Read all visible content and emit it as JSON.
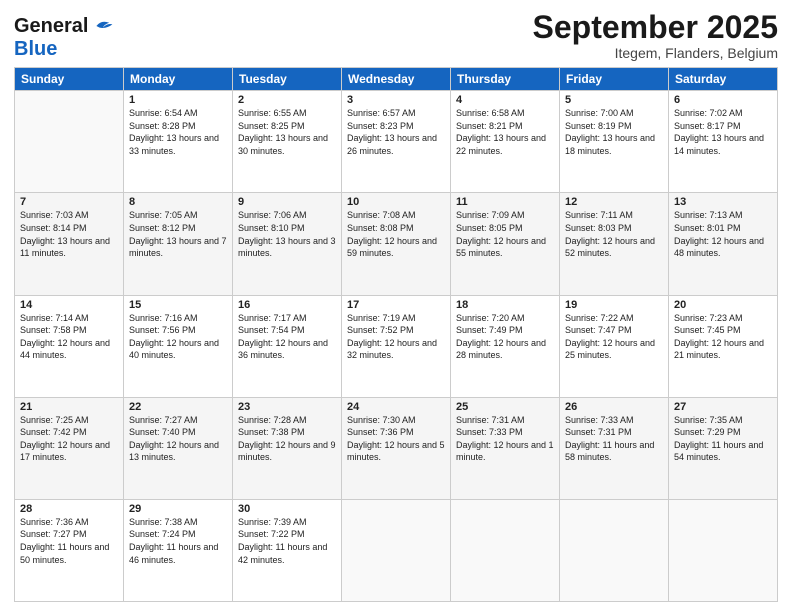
{
  "logo": {
    "line1": "General",
    "line2": "Blue"
  },
  "title": "September 2025",
  "subtitle": "Itegem, Flanders, Belgium",
  "days_header": [
    "Sunday",
    "Monday",
    "Tuesday",
    "Wednesday",
    "Thursday",
    "Friday",
    "Saturday"
  ],
  "weeks": [
    [
      {
        "num": "",
        "sunrise": "",
        "sunset": "",
        "daylight": ""
      },
      {
        "num": "1",
        "sunrise": "Sunrise: 6:54 AM",
        "sunset": "Sunset: 8:28 PM",
        "daylight": "Daylight: 13 hours and 33 minutes."
      },
      {
        "num": "2",
        "sunrise": "Sunrise: 6:55 AM",
        "sunset": "Sunset: 8:25 PM",
        "daylight": "Daylight: 13 hours and 30 minutes."
      },
      {
        "num": "3",
        "sunrise": "Sunrise: 6:57 AM",
        "sunset": "Sunset: 8:23 PM",
        "daylight": "Daylight: 13 hours and 26 minutes."
      },
      {
        "num": "4",
        "sunrise": "Sunrise: 6:58 AM",
        "sunset": "Sunset: 8:21 PM",
        "daylight": "Daylight: 13 hours and 22 minutes."
      },
      {
        "num": "5",
        "sunrise": "Sunrise: 7:00 AM",
        "sunset": "Sunset: 8:19 PM",
        "daylight": "Daylight: 13 hours and 18 minutes."
      },
      {
        "num": "6",
        "sunrise": "Sunrise: 7:02 AM",
        "sunset": "Sunset: 8:17 PM",
        "daylight": "Daylight: 13 hours and 14 minutes."
      }
    ],
    [
      {
        "num": "7",
        "sunrise": "Sunrise: 7:03 AM",
        "sunset": "Sunset: 8:14 PM",
        "daylight": "Daylight: 13 hours and 11 minutes."
      },
      {
        "num": "8",
        "sunrise": "Sunrise: 7:05 AM",
        "sunset": "Sunset: 8:12 PM",
        "daylight": "Daylight: 13 hours and 7 minutes."
      },
      {
        "num": "9",
        "sunrise": "Sunrise: 7:06 AM",
        "sunset": "Sunset: 8:10 PM",
        "daylight": "Daylight: 13 hours and 3 minutes."
      },
      {
        "num": "10",
        "sunrise": "Sunrise: 7:08 AM",
        "sunset": "Sunset: 8:08 PM",
        "daylight": "Daylight: 12 hours and 59 minutes."
      },
      {
        "num": "11",
        "sunrise": "Sunrise: 7:09 AM",
        "sunset": "Sunset: 8:05 PM",
        "daylight": "Daylight: 12 hours and 55 minutes."
      },
      {
        "num": "12",
        "sunrise": "Sunrise: 7:11 AM",
        "sunset": "Sunset: 8:03 PM",
        "daylight": "Daylight: 12 hours and 52 minutes."
      },
      {
        "num": "13",
        "sunrise": "Sunrise: 7:13 AM",
        "sunset": "Sunset: 8:01 PM",
        "daylight": "Daylight: 12 hours and 48 minutes."
      }
    ],
    [
      {
        "num": "14",
        "sunrise": "Sunrise: 7:14 AM",
        "sunset": "Sunset: 7:58 PM",
        "daylight": "Daylight: 12 hours and 44 minutes."
      },
      {
        "num": "15",
        "sunrise": "Sunrise: 7:16 AM",
        "sunset": "Sunset: 7:56 PM",
        "daylight": "Daylight: 12 hours and 40 minutes."
      },
      {
        "num": "16",
        "sunrise": "Sunrise: 7:17 AM",
        "sunset": "Sunset: 7:54 PM",
        "daylight": "Daylight: 12 hours and 36 minutes."
      },
      {
        "num": "17",
        "sunrise": "Sunrise: 7:19 AM",
        "sunset": "Sunset: 7:52 PM",
        "daylight": "Daylight: 12 hours and 32 minutes."
      },
      {
        "num": "18",
        "sunrise": "Sunrise: 7:20 AM",
        "sunset": "Sunset: 7:49 PM",
        "daylight": "Daylight: 12 hours and 28 minutes."
      },
      {
        "num": "19",
        "sunrise": "Sunrise: 7:22 AM",
        "sunset": "Sunset: 7:47 PM",
        "daylight": "Daylight: 12 hours and 25 minutes."
      },
      {
        "num": "20",
        "sunrise": "Sunrise: 7:23 AM",
        "sunset": "Sunset: 7:45 PM",
        "daylight": "Daylight: 12 hours and 21 minutes."
      }
    ],
    [
      {
        "num": "21",
        "sunrise": "Sunrise: 7:25 AM",
        "sunset": "Sunset: 7:42 PM",
        "daylight": "Daylight: 12 hours and 17 minutes."
      },
      {
        "num": "22",
        "sunrise": "Sunrise: 7:27 AM",
        "sunset": "Sunset: 7:40 PM",
        "daylight": "Daylight: 12 hours and 13 minutes."
      },
      {
        "num": "23",
        "sunrise": "Sunrise: 7:28 AM",
        "sunset": "Sunset: 7:38 PM",
        "daylight": "Daylight: 12 hours and 9 minutes."
      },
      {
        "num": "24",
        "sunrise": "Sunrise: 7:30 AM",
        "sunset": "Sunset: 7:36 PM",
        "daylight": "Daylight: 12 hours and 5 minutes."
      },
      {
        "num": "25",
        "sunrise": "Sunrise: 7:31 AM",
        "sunset": "Sunset: 7:33 PM",
        "daylight": "Daylight: 12 hours and 1 minute."
      },
      {
        "num": "26",
        "sunrise": "Sunrise: 7:33 AM",
        "sunset": "Sunset: 7:31 PM",
        "daylight": "Daylight: 11 hours and 58 minutes."
      },
      {
        "num": "27",
        "sunrise": "Sunrise: 7:35 AM",
        "sunset": "Sunset: 7:29 PM",
        "daylight": "Daylight: 11 hours and 54 minutes."
      }
    ],
    [
      {
        "num": "28",
        "sunrise": "Sunrise: 7:36 AM",
        "sunset": "Sunset: 7:27 PM",
        "daylight": "Daylight: 11 hours and 50 minutes."
      },
      {
        "num": "29",
        "sunrise": "Sunrise: 7:38 AM",
        "sunset": "Sunset: 7:24 PM",
        "daylight": "Daylight: 11 hours and 46 minutes."
      },
      {
        "num": "30",
        "sunrise": "Sunrise: 7:39 AM",
        "sunset": "Sunset: 7:22 PM",
        "daylight": "Daylight: 11 hours and 42 minutes."
      },
      {
        "num": "",
        "sunrise": "",
        "sunset": "",
        "daylight": ""
      },
      {
        "num": "",
        "sunrise": "",
        "sunset": "",
        "daylight": ""
      },
      {
        "num": "",
        "sunrise": "",
        "sunset": "",
        "daylight": ""
      },
      {
        "num": "",
        "sunrise": "",
        "sunset": "",
        "daylight": ""
      }
    ]
  ]
}
